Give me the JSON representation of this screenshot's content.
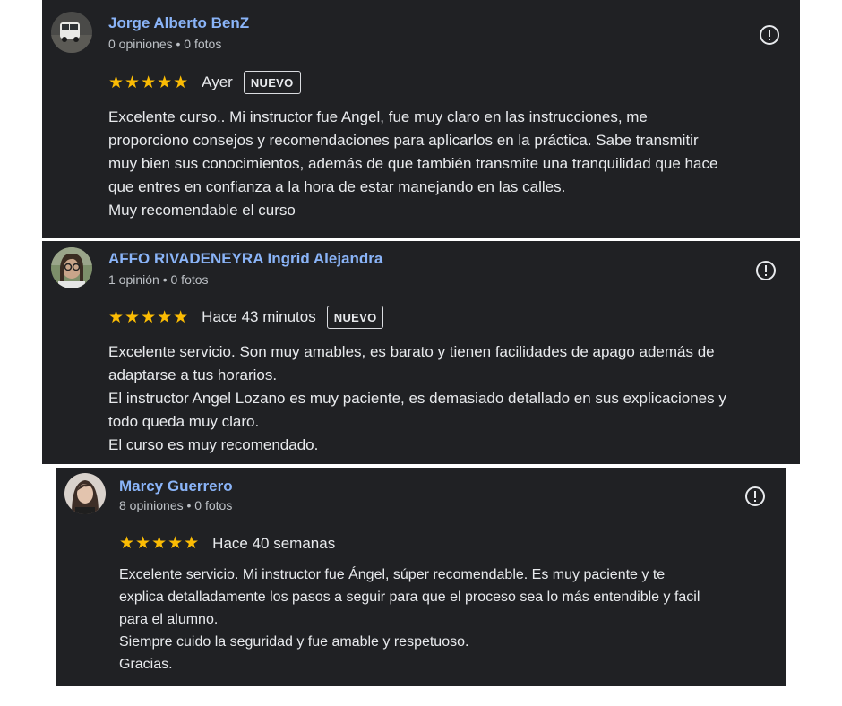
{
  "reviews": [
    {
      "name": "Jorge Alberto BenZ",
      "meta": "0 opiniones • 0 fotos",
      "stars": "★★★★★",
      "when": "Ayer",
      "badge": "NUEVO",
      "lines": [
        "Excelente curso.. Mi instructor fue Angel, fue muy claro en las instrucciones, me",
        "proporciono consejos y recomendaciones para aplicarlos en la práctica. Sabe transmitir",
        "muy bien sus conocimientos, además de que también transmite una tranquilidad que hace",
        "que entres en confianza a la hora de estar manejando en las calles.",
        "Muy recomendable el curso"
      ]
    },
    {
      "name": "AFFO RIVADENEYRA Ingrid Alejandra",
      "meta": "1 opinión • 0 fotos",
      "stars": "★★★★★",
      "when": "Hace 43 minutos",
      "badge": "NUEVO",
      "lines": [
        "Excelente servicio. Son muy amables, es barato y tienen facilidades de apago además de",
        "adaptarse a tus horarios.",
        "El instructor Angel Lozano es muy paciente, es demasiado detallado en sus explicaciones y",
        "todo queda muy claro.",
        "El curso es muy recomendado."
      ]
    },
    {
      "name": "Marcy Guerrero",
      "meta": "8 opiniones • 0 fotos",
      "stars": "★★★★★",
      "when": "Hace 40 semanas",
      "lines": [
        "Excelente servicio. Mi instructor fue Ángel, súper recomendable. Es muy paciente y te",
        "explica detalladamente los pasos a seguir para que el proceso sea lo más entendible y facil",
        "para el alumno.",
        "Siempre cuido la seguridad y fue amable y respetuoso.",
        "Gracias."
      ]
    }
  ]
}
